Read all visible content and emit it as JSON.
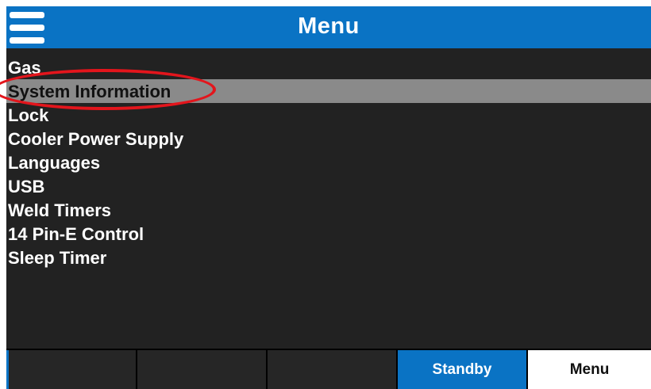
{
  "header": {
    "title": "Menu",
    "menu_icon": "hamburger-menu-icon",
    "color": "#0a73c4"
  },
  "menu": {
    "items": [
      {
        "label": "Gas"
      },
      {
        "label": "System Information",
        "selected": true
      },
      {
        "label": "Lock"
      },
      {
        "label": "Cooler Power Supply"
      },
      {
        "label": "Languages"
      },
      {
        "label": "USB"
      },
      {
        "label": "Weld Timers"
      },
      {
        "label": "14 Pin-E Control"
      },
      {
        "label": "Sleep Timer"
      }
    ],
    "selected_color": "#8a8a8a"
  },
  "annotation": {
    "color": "#e3151c"
  },
  "footer": {
    "buttons": [
      {
        "label": ""
      },
      {
        "label": ""
      },
      {
        "label": ""
      },
      {
        "label": "Standby",
        "active": true
      },
      {
        "label": "Menu"
      }
    ]
  }
}
